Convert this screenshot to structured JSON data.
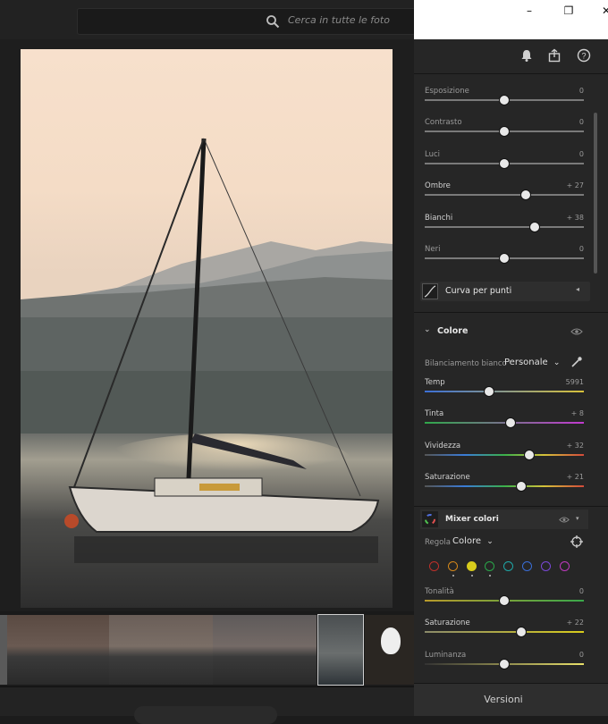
{
  "search": {
    "placeholder": "Cerca in tutte le foto"
  },
  "window_controls": {
    "minimize": "–",
    "restore": "❐",
    "close": "✕"
  },
  "panel_icons": [
    "bell-icon",
    "share-icon",
    "help-icon"
  ],
  "light_sliders": [
    {
      "label": "Esposizione",
      "value": "0",
      "level": 0.5
    },
    {
      "label": "Contrasto",
      "value": "0",
      "level": 0.5
    },
    {
      "label": "Luci",
      "value": "0",
      "level": 0.5
    },
    {
      "label": "Ombre",
      "value": "+ 27",
      "level": 0.635
    },
    {
      "label": "Bianchi",
      "value": "+ 38",
      "level": 0.69
    },
    {
      "label": "Neri",
      "value": "0",
      "level": 0.5
    }
  ],
  "curve": {
    "label": "Curva per punti"
  },
  "color_section": {
    "title": "Colore",
    "wb_label": "Bilanciamento bianco",
    "wb_value": "Personale",
    "sliders": [
      {
        "label": "Temp",
        "value": "5991",
        "level": 0.405,
        "gradient": "linear-gradient(90deg,#3b6fd6,#d8c23a)"
      },
      {
        "label": "Tinta",
        "value": "+ 8",
        "level": 0.54,
        "gradient": "linear-gradient(90deg,#2fa84a,#c23ad0)"
      },
      {
        "label": "Vividezza",
        "value": "+ 32",
        "level": 0.66,
        "gradient": "linear-gradient(90deg,#555,#3a7bd8,#3ab04a,#d4c23a,#d44a3a)"
      },
      {
        "label": "Saturazione",
        "value": "+ 21",
        "level": 0.605,
        "gradient": "linear-gradient(90deg,#555,#3a7bd8,#3ab04a,#d4c23a,#d44a3a)"
      }
    ]
  },
  "mixer": {
    "title": "Mixer colori",
    "regola_label": "Regola",
    "regola_value": "Colore",
    "swatches": [
      "#c0302a",
      "#d98a1a",
      "#d8cc1c",
      "#2aa84a",
      "#1fa8a8",
      "#3a6ed8",
      "#7a48d8",
      "#c03ac0"
    ],
    "sliders": [
      {
        "label": "Tonalità",
        "value": "0",
        "level": 0.5,
        "gradient": "linear-gradient(90deg,#b89a2a,#3aa84a)"
      },
      {
        "label": "Saturazione",
        "value": "+ 22",
        "level": 0.605,
        "gradient": "linear-gradient(90deg,#8a8a6a,#d8cc1c)"
      },
      {
        "label": "Luminanza",
        "value": "0",
        "level": 0.5,
        "gradient": "linear-gradient(90deg,#333,#e8e06a)"
      }
    ]
  },
  "versions": {
    "label": "Versioni"
  }
}
